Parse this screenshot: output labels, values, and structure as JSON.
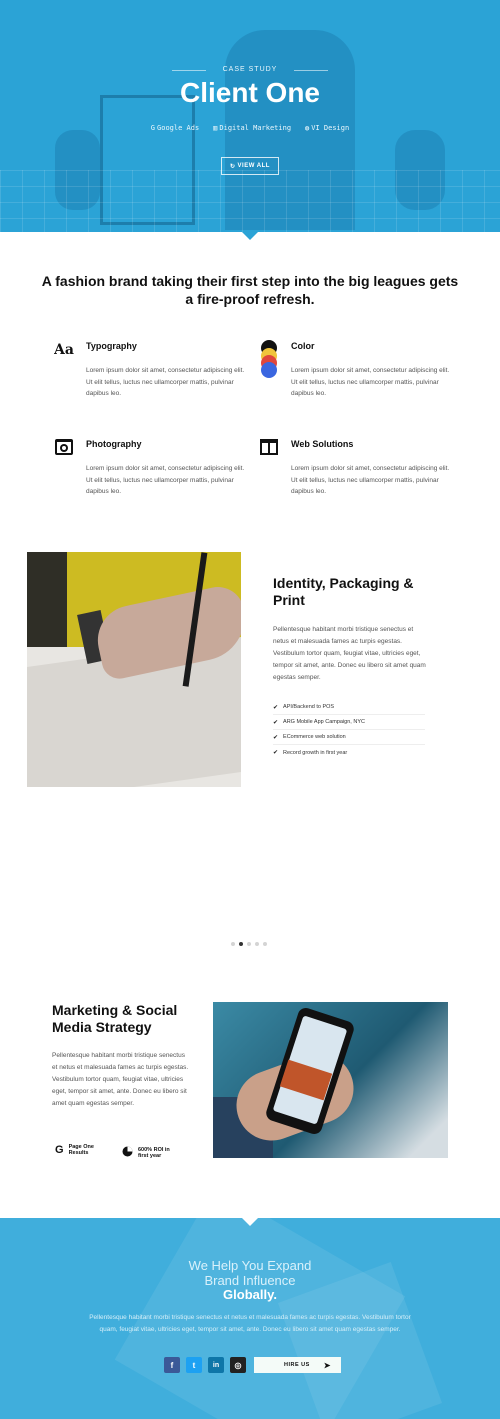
{
  "hero": {
    "eyebrow": "CASE STUDY",
    "title": "Client One",
    "tags": [
      {
        "icon": "google-icon",
        "label": "Google Ads"
      },
      {
        "icon": "chart-icon",
        "label": "Digital Marketing"
      },
      {
        "icon": "globe-icon",
        "label": "VI Design"
      }
    ],
    "button_label": "VIEW ALL"
  },
  "tagline": "A fashion brand taking their first step into the big leagues gets a fire-proof refresh.",
  "features": [
    {
      "icon": "typography-icon",
      "title": "Typography",
      "text": "Lorem ipsum dolor sit amet, consectetur adipiscing elit. Ut elit tellus, luctus nec ullamcorper mattis, pulvinar dapibus leo."
    },
    {
      "icon": "color-palette-icon",
      "title": "Color",
      "text": "Lorem ipsum dolor sit amet, consectetur adipiscing elit. Ut elit tellus, luctus nec ullamcorper mattis, pulvinar dapibus leo."
    },
    {
      "icon": "camera-icon",
      "title": "Photography",
      "text": "Lorem ipsum dolor sit amet, consectetur adipiscing elit. Ut elit tellus, luctus nec ullamcorper mattis, pulvinar dapibus leo."
    },
    {
      "icon": "browser-window-icon",
      "title": "Web Solutions",
      "text": "Lorem ipsum dolor sit amet, consectetur adipiscing elit. Ut elit tellus, luctus nec ullamcorper mattis, pulvinar dapibus leo."
    }
  ],
  "identity": {
    "title": "Identity, Packaging & Print",
    "text": "Pellentesque habitant morbi tristique senectus et netus et malesuada fames ac turpis egestas. Vestibulum tortor quam, feugiat vitae, ultricies eget, tempor sit amet, ante. Donec eu libero sit amet quam egestas semper.",
    "checklist": [
      "API/Backend to POS",
      "ARG Mobile App Campaign, NYC",
      "ECommerce web solution",
      "Record growth in first year"
    ]
  },
  "slider": {
    "count": 5,
    "active_index": 1
  },
  "marketing": {
    "title": "Marketing & Social Media Strategy",
    "text": "Pellentesque habitant morbi tristique senectus et netus et malesuada fames ac turpis egestas. Vestibulum tortor quam, feugiat vitae, ultricies eget, tempor sit amet, ante. Donec eu libero sit amet quam egestas semper.",
    "stats": [
      {
        "icon": "google-icon",
        "line1": "Page One",
        "line2": "Results"
      },
      {
        "icon": "pie-chart-icon",
        "line1": "600% ROI in",
        "line2": "first year"
      }
    ]
  },
  "footer": {
    "heading_line1": "We Help You Expand",
    "heading_line2": "Brand Influence",
    "heading_strong": "Globally.",
    "text": "Pellentesque habitant morbi tristique senectus et netus et malesuada fames ac turpis egestas. Vestibulum tortor quam, feugiat vitae, ultricies eget, tempor sit amet, ante. Donec eu libero sit amet quam egestas semper.",
    "social": [
      {
        "icon": "facebook-icon",
        "glyph": "f",
        "color": "#3b5998"
      },
      {
        "icon": "twitter-icon",
        "glyph": "t",
        "color": "#1da1f2"
      },
      {
        "icon": "linkedin-icon",
        "glyph": "in",
        "color": "#0e76a8"
      },
      {
        "icon": "instagram-icon",
        "glyph": "◎",
        "color": "#222222"
      }
    ],
    "hire_label": "HIRE US"
  },
  "colors": {
    "hero_bg": "#2ba3d6",
    "footer_bg": "#40aedc"
  }
}
